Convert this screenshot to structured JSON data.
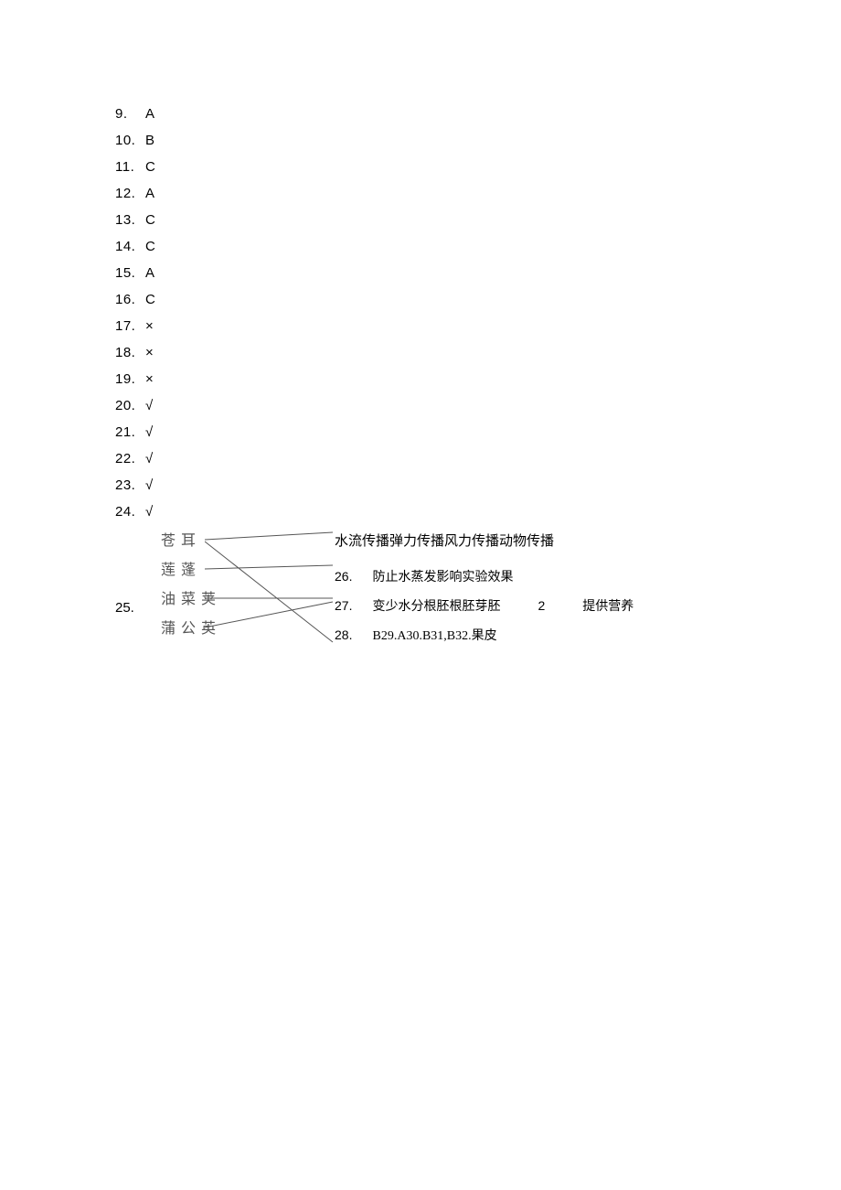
{
  "answers": [
    {
      "num": "9.",
      "val": "A"
    },
    {
      "num": "10.",
      "val": "B"
    },
    {
      "num": "11.",
      "val": "C"
    },
    {
      "num": "12.",
      "val": "A"
    },
    {
      "num": "13.",
      "val": "C"
    },
    {
      "num": "14.",
      "val": "C"
    },
    {
      "num": "15.",
      "val": "A"
    },
    {
      "num": "16.",
      "val": "C"
    },
    {
      "num": "17.",
      "val": "×"
    },
    {
      "num": "18.",
      "val": "×"
    },
    {
      "num": "19.",
      "val": "×"
    },
    {
      "num": "20.",
      "val": "√"
    },
    {
      "num": "21.",
      "val": "√"
    },
    {
      "num": "22.",
      "val": "√"
    },
    {
      "num": "23.",
      "val": "√"
    },
    {
      "num": "24.",
      "val": "√"
    }
  ],
  "q25": {
    "num": "25.",
    "left": [
      "苍耳",
      "莲蓬",
      "油菜荚",
      "蒲公英"
    ],
    "right_top": "水流传播弹力传播风力传播动物传播",
    "right_lines": {
      "l26": {
        "idx": "26.",
        "txt": "防止水蒸发影响实验效果"
      },
      "l27": {
        "idx": "27.",
        "txt1": "变少水分根胚根胚芽胚",
        "mid": "2",
        "txt2": "提供营养"
      },
      "l28": {
        "idx": "28.",
        "txt": "B29.A30.B31,B32.果皮"
      }
    }
  }
}
